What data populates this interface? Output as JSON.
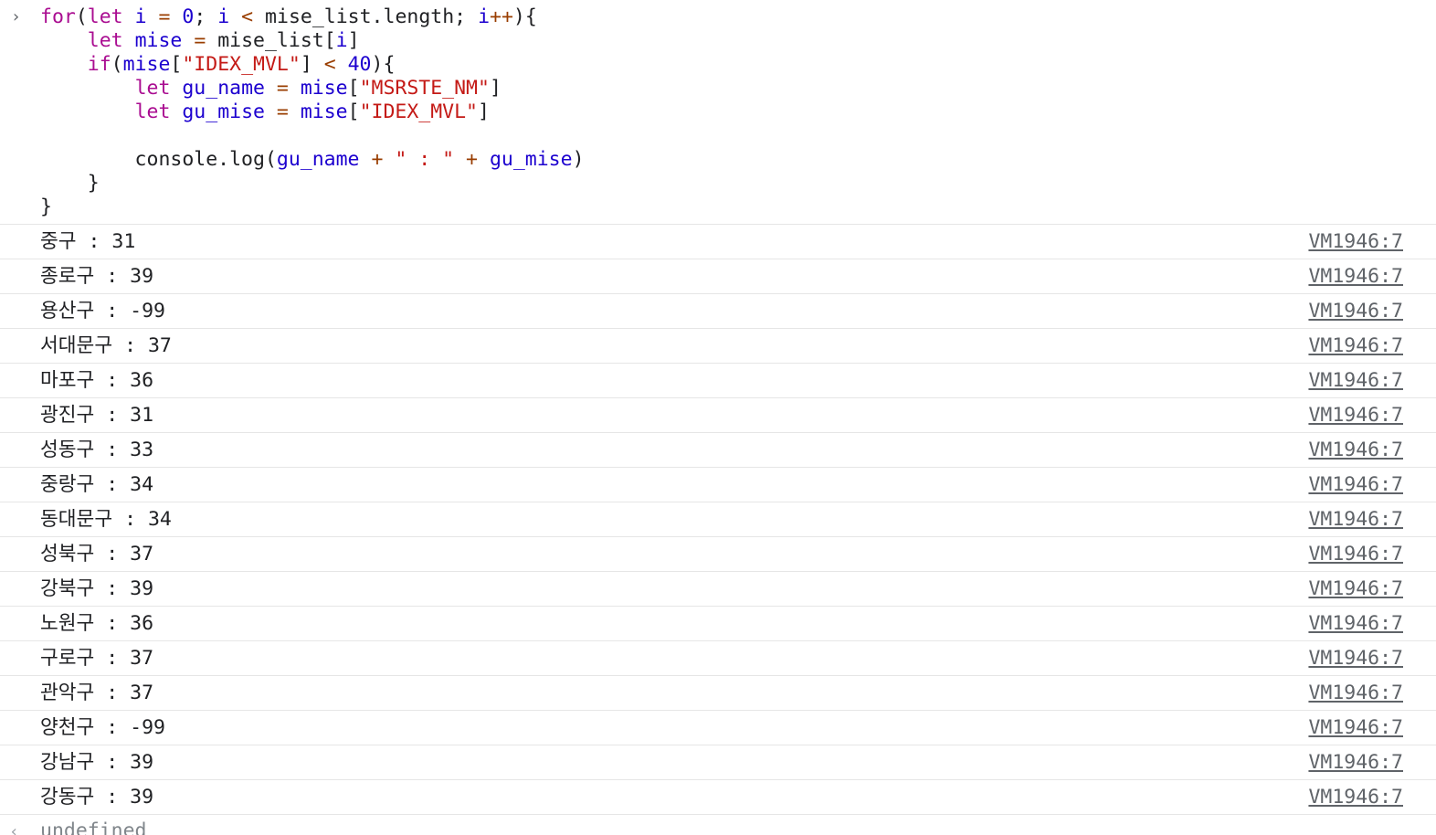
{
  "input": {
    "prompt_icon": "chevron-right-icon",
    "lines": [
      [
        [
          "kw",
          "for"
        ],
        [
          "pl",
          "("
        ],
        [
          "kw",
          "let"
        ],
        [
          "pl",
          " "
        ],
        [
          "var",
          "i"
        ],
        [
          "pl",
          " "
        ],
        [
          "op",
          "="
        ],
        [
          "pl",
          " "
        ],
        [
          "num",
          "0"
        ],
        [
          "pl",
          "; "
        ],
        [
          "var",
          "i"
        ],
        [
          "pl",
          " "
        ],
        [
          "op",
          "<"
        ],
        [
          "pl",
          " mise_list.length; "
        ],
        [
          "var",
          "i"
        ],
        [
          "op",
          "++"
        ],
        [
          "pl",
          "){"
        ]
      ],
      [
        [
          "pl",
          "    "
        ],
        [
          "kw",
          "let"
        ],
        [
          "pl",
          " "
        ],
        [
          "var",
          "mise"
        ],
        [
          "pl",
          " "
        ],
        [
          "op",
          "="
        ],
        [
          "pl",
          " mise_list["
        ],
        [
          "var",
          "i"
        ],
        [
          "pl",
          "]"
        ]
      ],
      [
        [
          "pl",
          "    "
        ],
        [
          "kw",
          "if"
        ],
        [
          "pl",
          "("
        ],
        [
          "var",
          "mise"
        ],
        [
          "pl",
          "["
        ],
        [
          "str",
          "\"IDEX_MVL\""
        ],
        [
          "pl",
          "] "
        ],
        [
          "op",
          "<"
        ],
        [
          "pl",
          " "
        ],
        [
          "num",
          "40"
        ],
        [
          "pl",
          "){"
        ]
      ],
      [
        [
          "pl",
          "        "
        ],
        [
          "kw",
          "let"
        ],
        [
          "pl",
          " "
        ],
        [
          "var",
          "gu_name"
        ],
        [
          "pl",
          " "
        ],
        [
          "op",
          "="
        ],
        [
          "pl",
          " "
        ],
        [
          "var",
          "mise"
        ],
        [
          "pl",
          "["
        ],
        [
          "str",
          "\"MSRSTE_NM\""
        ],
        [
          "pl",
          "]"
        ]
      ],
      [
        [
          "pl",
          "        "
        ],
        [
          "kw",
          "let"
        ],
        [
          "pl",
          " "
        ],
        [
          "var",
          "gu_mise"
        ],
        [
          "pl",
          " "
        ],
        [
          "op",
          "="
        ],
        [
          "pl",
          " "
        ],
        [
          "var",
          "mise"
        ],
        [
          "pl",
          "["
        ],
        [
          "str",
          "\"IDEX_MVL\""
        ],
        [
          "pl",
          "]"
        ]
      ],
      [
        [
          "pl",
          " "
        ]
      ],
      [
        [
          "pl",
          "        console.log("
        ],
        [
          "var",
          "gu_name"
        ],
        [
          "pl",
          " "
        ],
        [
          "op",
          "+"
        ],
        [
          "pl",
          " "
        ],
        [
          "str",
          "\" : \""
        ],
        [
          "pl",
          " "
        ],
        [
          "op",
          "+"
        ],
        [
          "pl",
          " "
        ],
        [
          "var",
          "gu_mise"
        ],
        [
          "pl",
          ")"
        ]
      ],
      [
        [
          "pl",
          "    }"
        ]
      ],
      [
        [
          "pl",
          "}"
        ]
      ]
    ]
  },
  "logs": [
    {
      "text": "중구 : 31",
      "source": "VM1946:7"
    },
    {
      "text": "종로구 : 39",
      "source": "VM1946:7"
    },
    {
      "text": "용산구 : -99",
      "source": "VM1946:7"
    },
    {
      "text": "서대문구 : 37",
      "source": "VM1946:7"
    },
    {
      "text": "마포구 : 36",
      "source": "VM1946:7"
    },
    {
      "text": "광진구 : 31",
      "source": "VM1946:7"
    },
    {
      "text": "성동구 : 33",
      "source": "VM1946:7"
    },
    {
      "text": "중랑구 : 34",
      "source": "VM1946:7"
    },
    {
      "text": "동대문구 : 34",
      "source": "VM1946:7"
    },
    {
      "text": "성북구 : 37",
      "source": "VM1946:7"
    },
    {
      "text": "강북구 : 39",
      "source": "VM1946:7"
    },
    {
      "text": "노원구 : 36",
      "source": "VM1946:7"
    },
    {
      "text": "구로구 : 37",
      "source": "VM1946:7"
    },
    {
      "text": "관악구 : 37",
      "source": "VM1946:7"
    },
    {
      "text": "양천구 : -99",
      "source": "VM1946:7"
    },
    {
      "text": "강남구 : 39",
      "source": "VM1946:7"
    },
    {
      "text": "강동구 : 39",
      "source": "VM1946:7"
    }
  ],
  "result": {
    "icon": "return-arrow-icon",
    "text": "undefined"
  }
}
